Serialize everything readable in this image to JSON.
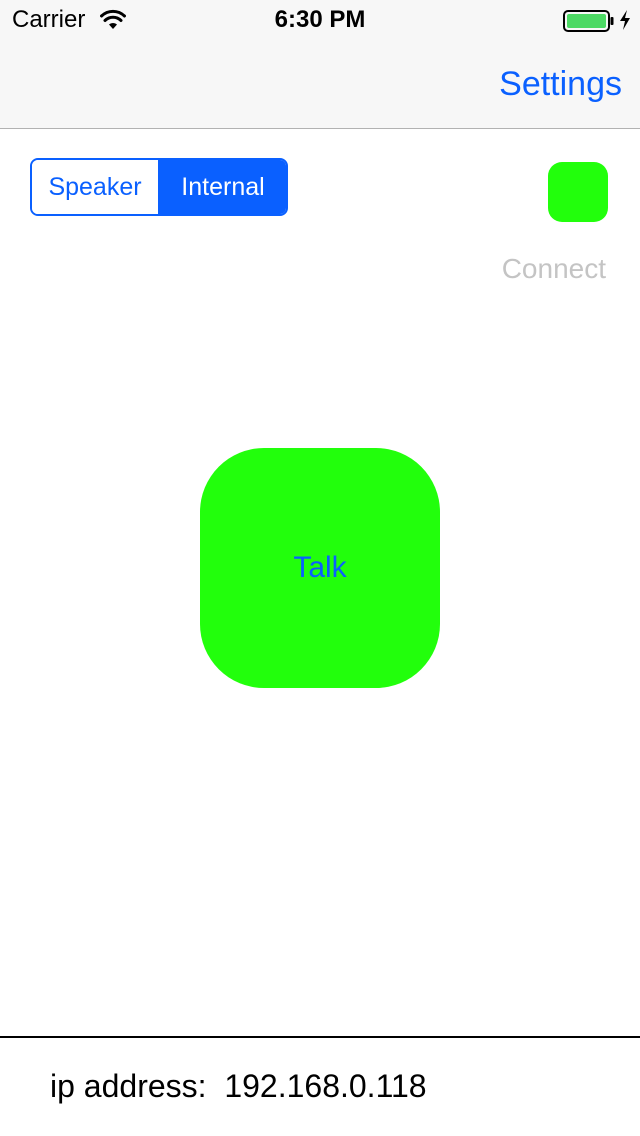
{
  "status_bar": {
    "carrier": "Carrier",
    "time": "6:30 PM",
    "wifi_icon": "wifi-icon",
    "battery_icon": "battery-icon",
    "charging_icon": "bolt-icon"
  },
  "nav": {
    "settings_label": "Settings"
  },
  "audio_output": {
    "options": [
      "Speaker",
      "Internal"
    ],
    "selected": "Internal"
  },
  "connection": {
    "indicator_color": "#22ff0c",
    "connect_label": "Connect"
  },
  "talk": {
    "label": "Talk",
    "color": "#22ff0c"
  },
  "footer": {
    "ip_label": "ip address:",
    "ip_value": "192.168.0.118"
  },
  "colors": {
    "accent": "#0a60ff",
    "active_green": "#22ff0c",
    "disabled_text": "#c4c4c4"
  }
}
